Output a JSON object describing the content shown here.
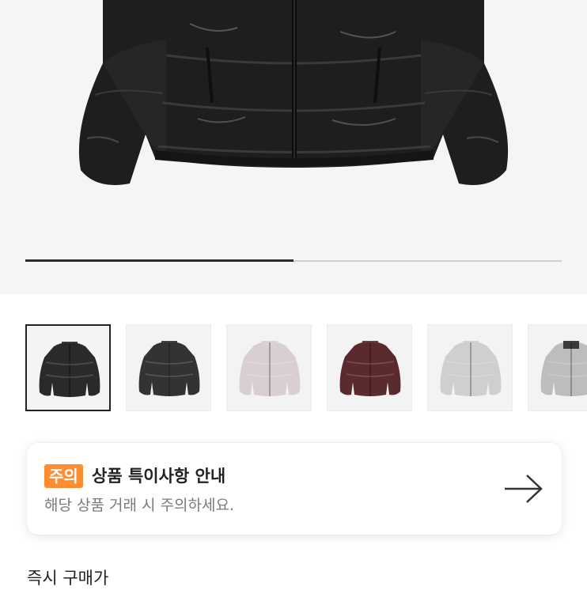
{
  "gallery": {
    "image_name": "jacket-photo",
    "current_index": 1,
    "slide_progress": 0.5,
    "thumbnails": [
      {
        "name": "black-front",
        "color": "#2a2a2a",
        "selected": true
      },
      {
        "name": "black-alt",
        "color": "#333333",
        "selected": false
      },
      {
        "name": "light-pink",
        "color": "#d9cfd1",
        "selected": false
      },
      {
        "name": "burgundy",
        "color": "#5a2a2e",
        "selected": false
      },
      {
        "name": "light-grey",
        "color": "#cfcfcf",
        "selected": false
      },
      {
        "name": "silver-black",
        "color": "#bdbdbd",
        "selected": false
      }
    ]
  },
  "notice": {
    "badge": "주의",
    "title": "상품 특이사항 안내",
    "subtitle": "해당 상품 거래 시 주의하세요.",
    "arrow_icon": "arrow-right-icon",
    "badge_color": "#ff8c2e"
  },
  "price_section": {
    "title": "즉시 구매가"
  }
}
